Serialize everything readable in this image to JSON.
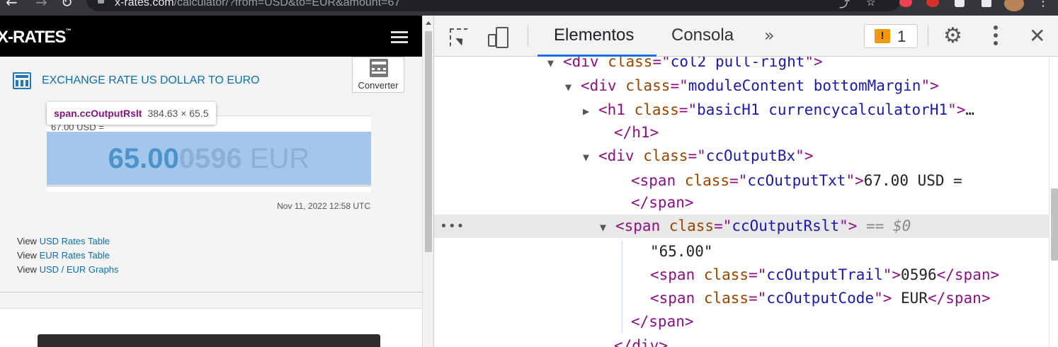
{
  "browser": {
    "url_host": "x-rates.com",
    "url_path": "/calculator/?from=USD&to=EUR&amount=67",
    "extensions": [
      "pocket-icon",
      "adblock-icon",
      "puzzle-icon",
      "window-icon",
      "profile-avatar"
    ]
  },
  "site": {
    "logo": "X-RATES",
    "title": "EXCHANGE RATE US DOLLAR TO EURO",
    "converter_label": "Converter",
    "output_txt": "67.00 USD =",
    "result_value": "65.00",
    "result_trail": "0596",
    "result_code": " EUR",
    "timestamp": "Nov 11, 2022 12:58 UTC",
    "tooltip_tag": "span.ccOutputRslt",
    "tooltip_dims": "384.63 × 65.5",
    "links": [
      {
        "prefix": "View ",
        "label": "USD Rates Table"
      },
      {
        "prefix": "View ",
        "label": "EUR Rates Table"
      },
      {
        "prefix": "View ",
        "label": "USD / EUR Graphs"
      }
    ]
  },
  "devtools": {
    "tabs": [
      "Elementos",
      "Consola"
    ],
    "more_tabs": "»",
    "issues_count": "1",
    "issues_badge": "!",
    "dom_lines": [
      {
        "parts": [
          [
            "t",
            "<div "
          ],
          [
            "an",
            "class"
          ],
          [
            "t",
            "=\""
          ],
          [
            "av",
            "col2 pull-right"
          ],
          [
            "t",
            "\">"
          ]
        ]
      },
      {
        "parts": [
          [
            "t",
            "<div "
          ],
          [
            "an",
            "class"
          ],
          [
            "t",
            "=\""
          ],
          [
            "av",
            "moduleContent bottomMargin"
          ],
          [
            "t",
            "\">"
          ]
        ]
      },
      {
        "parts": [
          [
            "t",
            "<h1 "
          ],
          [
            "an",
            "class"
          ],
          [
            "t",
            "=\""
          ],
          [
            "av",
            "basicH1 currencycalculatorH1"
          ],
          [
            "t",
            "\">"
          ],
          [
            "tx",
            "…"
          ]
        ]
      },
      {
        "parts": [
          [
            "t",
            "</h1>"
          ]
        ]
      },
      {
        "parts": [
          [
            "t",
            "<div "
          ],
          [
            "an",
            "class"
          ],
          [
            "t",
            "=\""
          ],
          [
            "av",
            "ccOutputBx"
          ],
          [
            "t",
            "\">"
          ]
        ]
      },
      {
        "parts": [
          [
            "t",
            "<span "
          ],
          [
            "an",
            "class"
          ],
          [
            "t",
            "=\""
          ],
          [
            "av",
            "ccOutputTxt"
          ],
          [
            "t",
            "\">"
          ],
          [
            "tx",
            "67.00 USD ="
          ]
        ]
      },
      {
        "parts": [
          [
            "t",
            "</span>"
          ]
        ]
      },
      {
        "parts": [
          [
            "t",
            "<span "
          ],
          [
            "an",
            "class"
          ],
          [
            "t",
            "=\""
          ],
          [
            "av",
            "ccOutputRslt"
          ],
          [
            "t",
            "\">"
          ],
          [
            "eq",
            " == $0"
          ]
        ]
      },
      {
        "parts": [
          [
            "tx",
            "\"65.00\""
          ]
        ]
      },
      {
        "parts": [
          [
            "t",
            "<span "
          ],
          [
            "an",
            "class"
          ],
          [
            "t",
            "=\""
          ],
          [
            "av",
            "ccOutputTrail"
          ],
          [
            "t",
            "\">"
          ],
          [
            "tx",
            "0596"
          ],
          [
            "t",
            "</span>"
          ]
        ]
      },
      {
        "parts": [
          [
            "t",
            "<span "
          ],
          [
            "an",
            "class"
          ],
          [
            "t",
            "=\""
          ],
          [
            "av",
            "ccOutputCode"
          ],
          [
            "t",
            "\">"
          ],
          [
            "tx",
            " EUR"
          ],
          [
            "t",
            "</span>"
          ]
        ]
      },
      {
        "parts": [
          [
            "t",
            "</span>"
          ]
        ]
      },
      {
        "parts": [
          [
            "t",
            "</div>"
          ]
        ]
      }
    ]
  }
}
